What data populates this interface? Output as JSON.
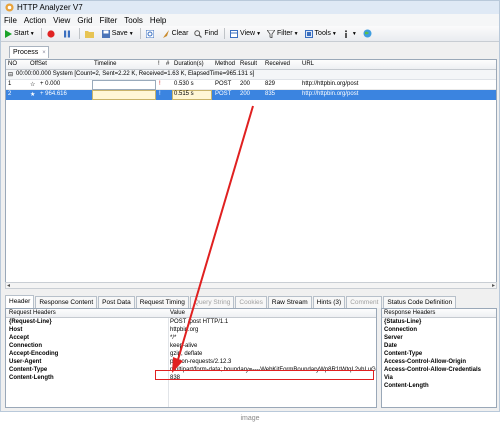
{
  "window": {
    "title": "HTTP Analyzer V7"
  },
  "menu": [
    "File",
    "Action",
    "View",
    "Grid",
    "Filter",
    "Tools",
    "Help"
  ],
  "toolbar": {
    "start": "Start",
    "save": "Save",
    "clear": "Clear",
    "find": "Find",
    "view": "View",
    "filter": "Filter",
    "tools": "Tools"
  },
  "process_tab": {
    "label": "Process",
    "close": "×"
  },
  "grid": {
    "headers": [
      "NO",
      "OffSet",
      "Timeline",
      "!",
      "#",
      "Duration(s)",
      "Method",
      "Result",
      "Received",
      "URL"
    ],
    "group_row": "00:00:00.000  System  [Count=2, Sent=2.22 K, Received=1.63 K, ElapsedTime=965.131 s]",
    "rows": [
      {
        "no": "1",
        "offset": "+ 0.000",
        "flag": "!",
        "duration": "0.530 s",
        "method": "POST",
        "result": "200",
        "received": "829",
        "url": "http://httpbin.org/post"
      },
      {
        "no": "2",
        "offset": "+ 964.616",
        "flag": "!",
        "duration": "0.515 s",
        "method": "POST",
        "result": "200",
        "received": "835",
        "url": "http://httpbin.org/post"
      }
    ]
  },
  "detail_tabs": [
    {
      "label": "Header",
      "state": "active"
    },
    {
      "label": "Response Content",
      "state": "normal"
    },
    {
      "label": "Post Data",
      "state": "normal"
    },
    {
      "label": "Request Timing",
      "state": "normal"
    },
    {
      "label": "Query String",
      "state": "disabled"
    },
    {
      "label": "Cookies",
      "state": "disabled"
    },
    {
      "label": "Raw Stream",
      "state": "normal"
    },
    {
      "label": "Hints (3)",
      "state": "normal"
    },
    {
      "label": "Comment",
      "state": "disabled"
    },
    {
      "label": "Status Code Definition",
      "state": "normal"
    }
  ],
  "request": {
    "col_headers": {
      "name": "Request Headers",
      "value": "Value"
    },
    "rows": [
      {
        "name": "{Request-Line}",
        "value": "POST /post HTTP/1.1"
      },
      {
        "name": "Host",
        "value": "httpbin.org"
      },
      {
        "name": "Accept",
        "value": "*/*"
      },
      {
        "name": "Connection",
        "value": "keep-alive"
      },
      {
        "name": "Accept-Encoding",
        "value": "gzip, deflate"
      },
      {
        "name": "User-Agent",
        "value": "python-requests/2.12.3"
      },
      {
        "name": "Content-Type",
        "value": "multipart/form-data; boundary=----WebKitFormBoundaryWp8R1tWtqL2vhLuG"
      },
      {
        "name": "Content-Length",
        "value": "838"
      }
    ]
  },
  "response": {
    "col_header": "Response Headers",
    "rows": [
      "{Status-Line}",
      "Connection",
      "Server",
      "Date",
      "Content-Type",
      "Access-Control-Allow-Origin",
      "Access-Control-Allow-Credentials",
      "Via",
      "Content-Length"
    ]
  },
  "caption": "image",
  "colors": {
    "selection": "#3b84e0",
    "annotation": "#e02020",
    "titlebar": "#dfe9f5"
  }
}
